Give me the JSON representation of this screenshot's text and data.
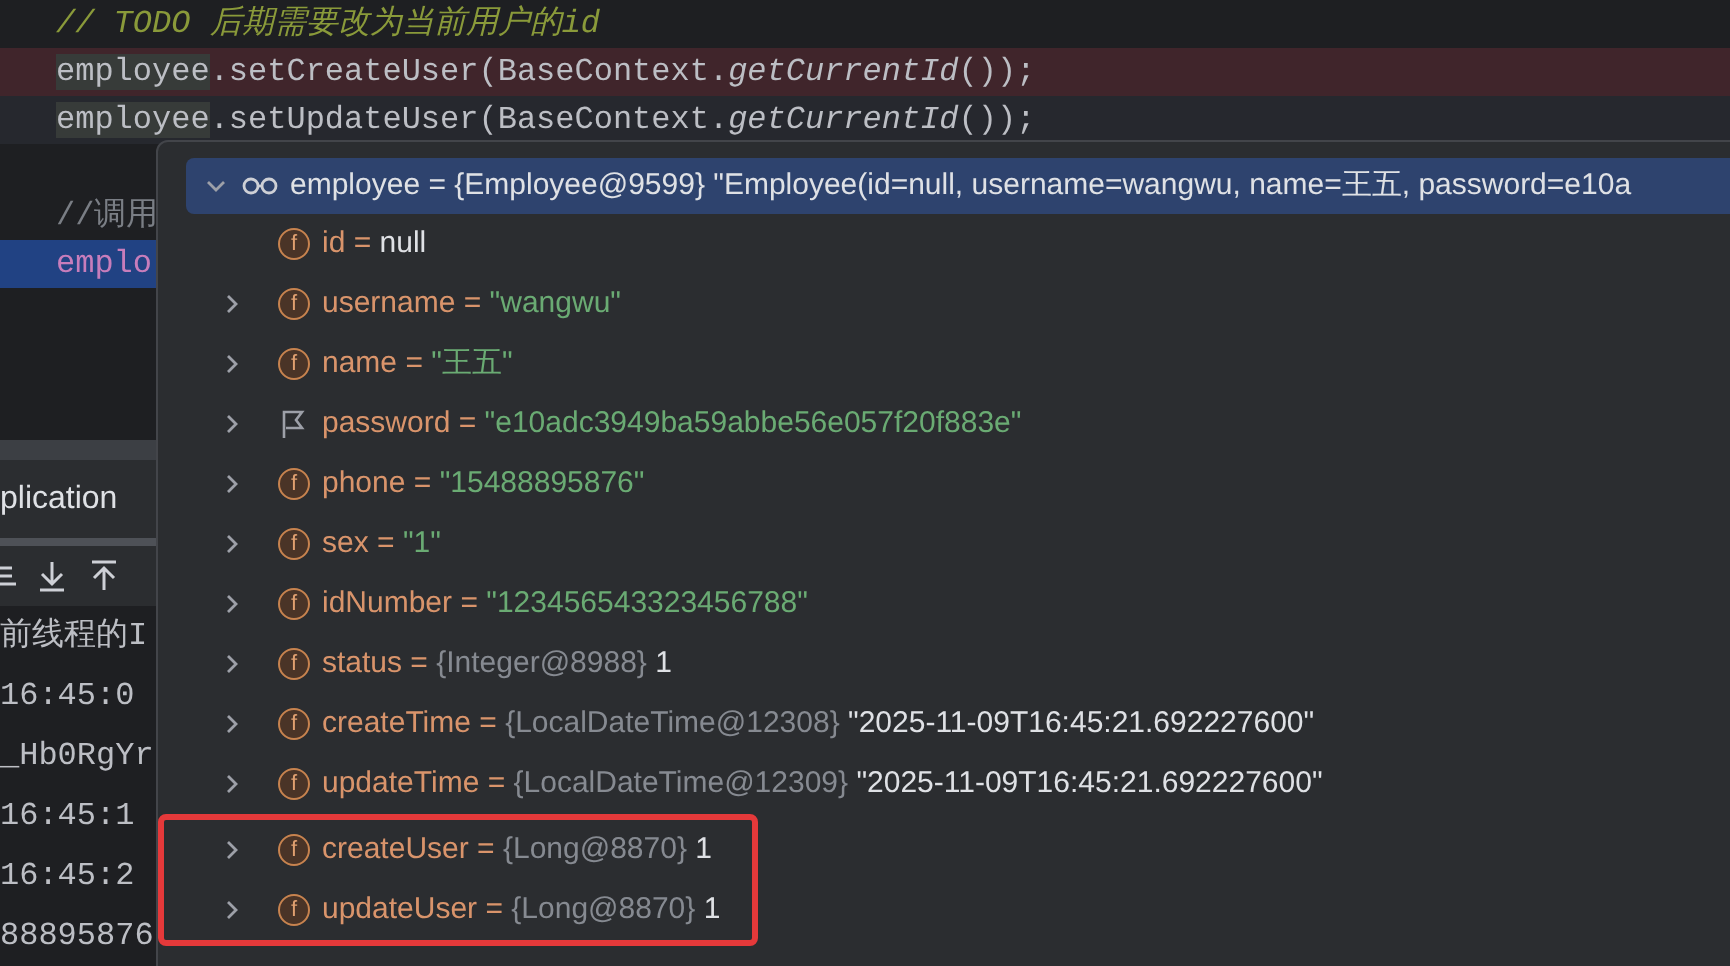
{
  "editor": {
    "lines": [
      {
        "kind": "comment",
        "text": "// TODO 后期需要改为当前用户的id"
      },
      {
        "kind": "breakpoint",
        "receiver": "employee",
        "call": ".setCreateUser(BaseContext.",
        "method": "getCurrentId",
        "tail": "());"
      },
      {
        "kind": "execution",
        "receiver": "employee",
        "call": ".setUpdateUser(BaseContext.",
        "method": "getCurrentId",
        "tail": "());"
      },
      {
        "kind": "blank"
      },
      {
        "kind": "comment",
        "text": "//调用"
      },
      {
        "kind": "selection",
        "text": "emplo"
      }
    ]
  },
  "run_panel": {
    "tab": "plication",
    "console_lines": [
      "前线程的I",
      "16:45:0",
      "_Hb0RgYr",
      "16:45:1",
      "16:45:2",
      "88895876"
    ]
  },
  "debugger": {
    "root": {
      "name": "employee =",
      "type": "{Employee@9599}",
      "value": "\"Employee(id=null, username=wangwu, name=王五, password=e10a",
      "selected": true,
      "expanded": true
    },
    "fields": [
      {
        "kind": "value",
        "badge": "f",
        "expandable": false,
        "name": "id =",
        "value": "null"
      },
      {
        "kind": "string",
        "badge": "f",
        "expandable": true,
        "name": "username =",
        "value": "\"wangwu\""
      },
      {
        "kind": "string",
        "badge": "f",
        "expandable": true,
        "name": "name =",
        "value": "\"王五\""
      },
      {
        "kind": "flagged",
        "expandable": true,
        "name": "password =",
        "value": "\"e10adc3949ba59abbe56e057f20f883e\""
      },
      {
        "kind": "string",
        "badge": "f",
        "expandable": true,
        "name": "phone =",
        "value": "\"15488895876\""
      },
      {
        "kind": "string",
        "badge": "f",
        "expandable": true,
        "name": "sex =",
        "value": "\"1\""
      },
      {
        "kind": "string",
        "badge": "f",
        "expandable": true,
        "name": "idNumber =",
        "value": "\"123456543323456788\""
      },
      {
        "kind": "value",
        "badge": "f",
        "expandable": true,
        "name": "status =",
        "type": "{Integer@8988}",
        "value": "1"
      },
      {
        "kind": "value",
        "badge": "f",
        "expandable": true,
        "name": "createTime =",
        "type": "{LocalDateTime@12308}",
        "value": "\"2025-11-09T16:45:21.692227600\""
      },
      {
        "kind": "value",
        "badge": "f",
        "expandable": true,
        "name": "updateTime =",
        "type": "{LocalDateTime@12309}",
        "value": "\"2025-11-09T16:45:21.692227600\""
      }
    ],
    "annotated_fields": [
      {
        "kind": "value",
        "badge": "f",
        "expandable": true,
        "name": "createUser =",
        "type": "{Long@8870}",
        "value": "1"
      },
      {
        "kind": "value",
        "badge": "f",
        "expandable": true,
        "name": "updateUser =",
        "type": "{Long@8870}",
        "value": "1"
      }
    ]
  }
}
